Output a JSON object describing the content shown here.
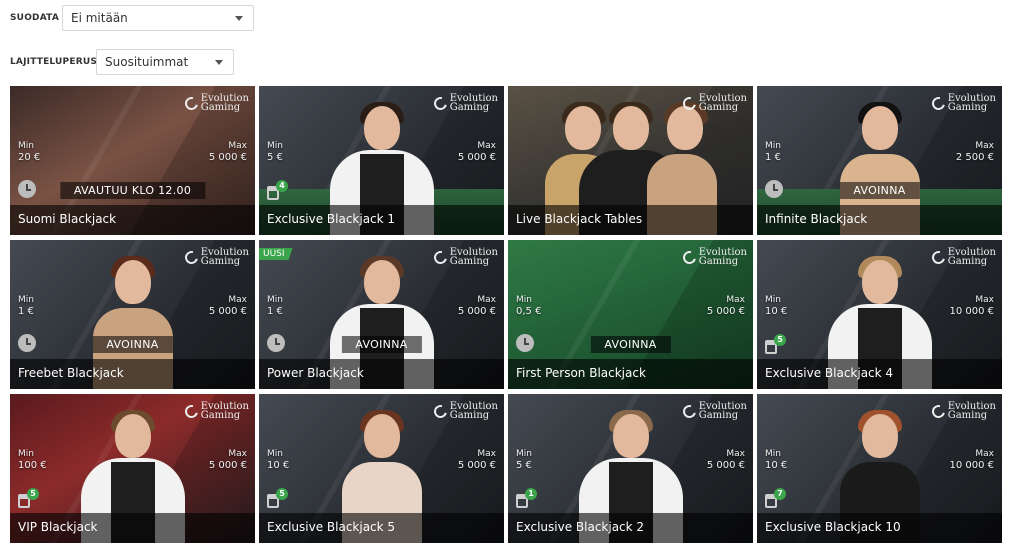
{
  "filter": {
    "label": "SUODATA",
    "value": "Ei mitään"
  },
  "sort": {
    "label": "LAJITTELUPERUSTE",
    "value": "Suosituimmat"
  },
  "provider_logo_text": [
    "Evolution",
    "Gaming"
  ],
  "limit_labels": {
    "min": "Min",
    "max": "Max"
  },
  "new_badge": "UUSI",
  "tiles": [
    {
      "name": "Suomi Blackjack",
      "min": "20 €",
      "max": "5 000 €",
      "status": "AVAUTUU KLO 12.00",
      "indicator": "clock",
      "seats": null,
      "new": false
    },
    {
      "name": "Exclusive Blackjack 1",
      "min": "5 €",
      "max": "5 000 €",
      "status": "",
      "indicator": "seat",
      "seats": "4",
      "new": false
    },
    {
      "name": "Live Blackjack Tables",
      "min": "",
      "max": "",
      "status": "",
      "indicator": "none",
      "seats": null,
      "new": false
    },
    {
      "name": "Infinite Blackjack",
      "min": "1 €",
      "max": "2 500 €",
      "status": "AVOINNA",
      "indicator": "clock",
      "seats": null,
      "new": false
    },
    {
      "name": "Freebet Blackjack",
      "min": "1 €",
      "max": "5 000 €",
      "status": "AVOINNA",
      "indicator": "clock",
      "seats": null,
      "new": false
    },
    {
      "name": "Power Blackjack",
      "min": "1 €",
      "max": "5 000 €",
      "status": "AVOINNA",
      "indicator": "clock",
      "seats": null,
      "new": true
    },
    {
      "name": "First Person Blackjack",
      "min": "0,5 €",
      "max": "5 000 €",
      "status": "AVOINNA",
      "indicator": "clock",
      "seats": null,
      "new": false
    },
    {
      "name": "Exclusive Blackjack 4",
      "min": "10 €",
      "max": "10 000 €",
      "status": "",
      "indicator": "seat",
      "seats": "5",
      "new": false
    },
    {
      "name": "VIP Blackjack",
      "min": "100 €",
      "max": "5 000 €",
      "status": "",
      "indicator": "seat",
      "seats": "5",
      "new": false
    },
    {
      "name": "Exclusive Blackjack 5",
      "min": "10 €",
      "max": "5 000 €",
      "status": "",
      "indicator": "seat",
      "seats": "5",
      "new": false
    },
    {
      "name": "Exclusive Blackjack 2",
      "min": "5 €",
      "max": "5 000 €",
      "status": "",
      "indicator": "seat",
      "seats": "1",
      "new": false
    },
    {
      "name": "Exclusive Blackjack 10",
      "min": "10 €",
      "max": "10 000 €",
      "status": "",
      "indicator": "seat",
      "seats": "7",
      "new": false
    }
  ]
}
